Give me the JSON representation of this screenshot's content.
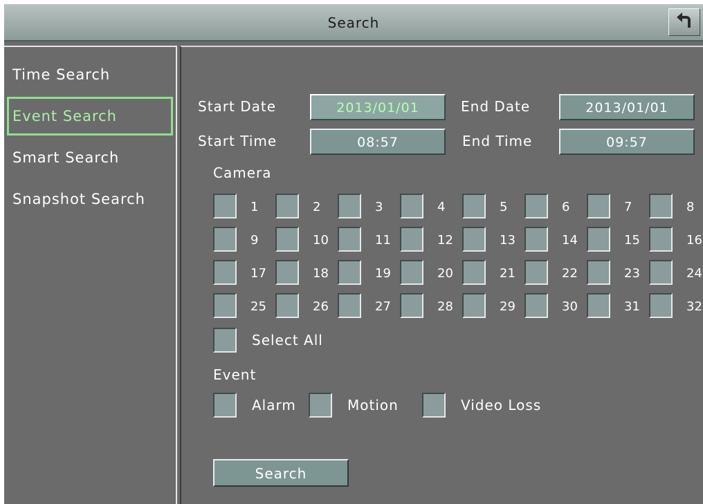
{
  "title": "Search",
  "icons": {
    "back": "back-arrow-icon"
  },
  "sidebar": {
    "items": [
      {
        "label": "Time Search"
      },
      {
        "label": "Event Search",
        "active": true
      },
      {
        "label": "Smart Search"
      },
      {
        "label": "Snapshot Search"
      }
    ]
  },
  "form": {
    "start_date_label": "Start Date",
    "start_date_value": "2013/01/01",
    "end_date_label": "End Date",
    "end_date_value": "2013/01/01",
    "start_time_label": "Start Time",
    "start_time_value": "08:57",
    "end_time_label": "End Time",
    "end_time_value": "09:57",
    "camera_label": "Camera",
    "cameras": [
      "1",
      "2",
      "3",
      "4",
      "5",
      "6",
      "7",
      "8",
      "9",
      "10",
      "11",
      "12",
      "13",
      "14",
      "15",
      "16",
      "17",
      "18",
      "19",
      "20",
      "21",
      "22",
      "23",
      "24",
      "25",
      "26",
      "27",
      "28",
      "29",
      "30",
      "31",
      "32"
    ],
    "select_all_label": "Select All",
    "event_label": "Event",
    "events": [
      "Alarm",
      "Motion",
      "Video Loss"
    ],
    "search_button": "Search"
  },
  "colors": {
    "background": "#6b6b6b",
    "field": "#7d9694",
    "active_accent": "#8fe08f",
    "titlebar": "#a6b3b1"
  }
}
